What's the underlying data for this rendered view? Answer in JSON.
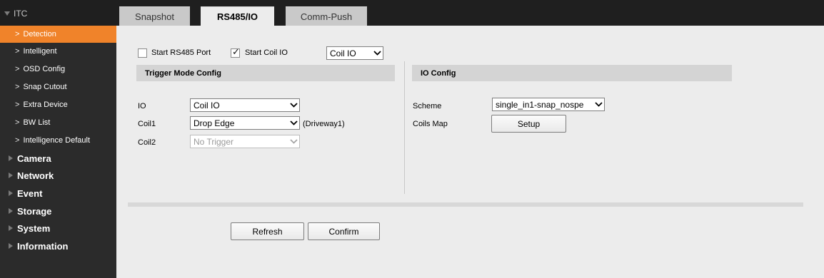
{
  "sidebar": {
    "root_label": "ITC",
    "sub_items": [
      {
        "label": "Detection",
        "active": true
      },
      {
        "label": "Intelligent"
      },
      {
        "label": "OSD Config"
      },
      {
        "label": "Snap Cutout"
      },
      {
        "label": "Extra Device"
      },
      {
        "label": "BW List"
      },
      {
        "label": "Intelligence Default"
      }
    ],
    "main_items": [
      {
        "label": "Camera"
      },
      {
        "label": "Network"
      },
      {
        "label": "Event"
      },
      {
        "label": "Storage"
      },
      {
        "label": "System"
      },
      {
        "label": "Information"
      }
    ],
    "arrow_glyph": ">"
  },
  "tabs": [
    {
      "label": "Snapshot"
    },
    {
      "label": "RS485/IO",
      "active": true
    },
    {
      "label": "Comm-Push"
    }
  ],
  "options": {
    "rs485": {
      "label": "Start RS485 Port",
      "checked": false
    },
    "coil_io": {
      "label": "Start Coil IO",
      "checked": true
    },
    "mode_select": "Coil IO"
  },
  "trigger_mode": {
    "header": "Trigger Mode Config",
    "io": {
      "label": "IO",
      "value": "Coil IO"
    },
    "coil1": {
      "label": "Coil1",
      "value": "Drop Edge",
      "suffix": "(Driveway1)"
    },
    "coil2": {
      "label": "Coil2",
      "value": "No Trigger",
      "disabled": true
    }
  },
  "io_config": {
    "header": "IO Config",
    "scheme": {
      "label": "Scheme",
      "value": "single_in1-snap_nospe"
    },
    "coils_map": {
      "label": "Coils Map",
      "button": "Setup"
    }
  },
  "actions": {
    "refresh": "Refresh",
    "confirm": "Confirm"
  },
  "colors": {
    "accent": "#f0832a",
    "sidebar_bg": "#2b2b2b",
    "content_bg": "#ececec"
  }
}
